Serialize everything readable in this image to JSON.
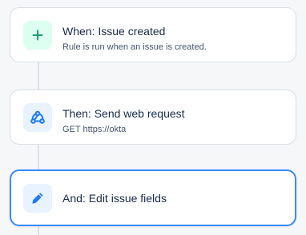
{
  "rules": [
    {
      "title": "When: Issue created",
      "subtitle": "Rule is run when an issue is created.",
      "icon": "plus-icon"
    },
    {
      "title": "Then: Send web request",
      "subtitle": "GET https://okta",
      "icon": "webhook-icon"
    },
    {
      "title": "And: Edit issue fields",
      "subtitle": "",
      "icon": "pencil-icon",
      "selected": true
    }
  ],
  "colors": {
    "trigger_tile": "#dcfff1",
    "trigger_icon": "#22a06b",
    "action_tile": "#e9f2ff",
    "action_icon": "#1d7afc",
    "selected_border": "#388bff"
  }
}
